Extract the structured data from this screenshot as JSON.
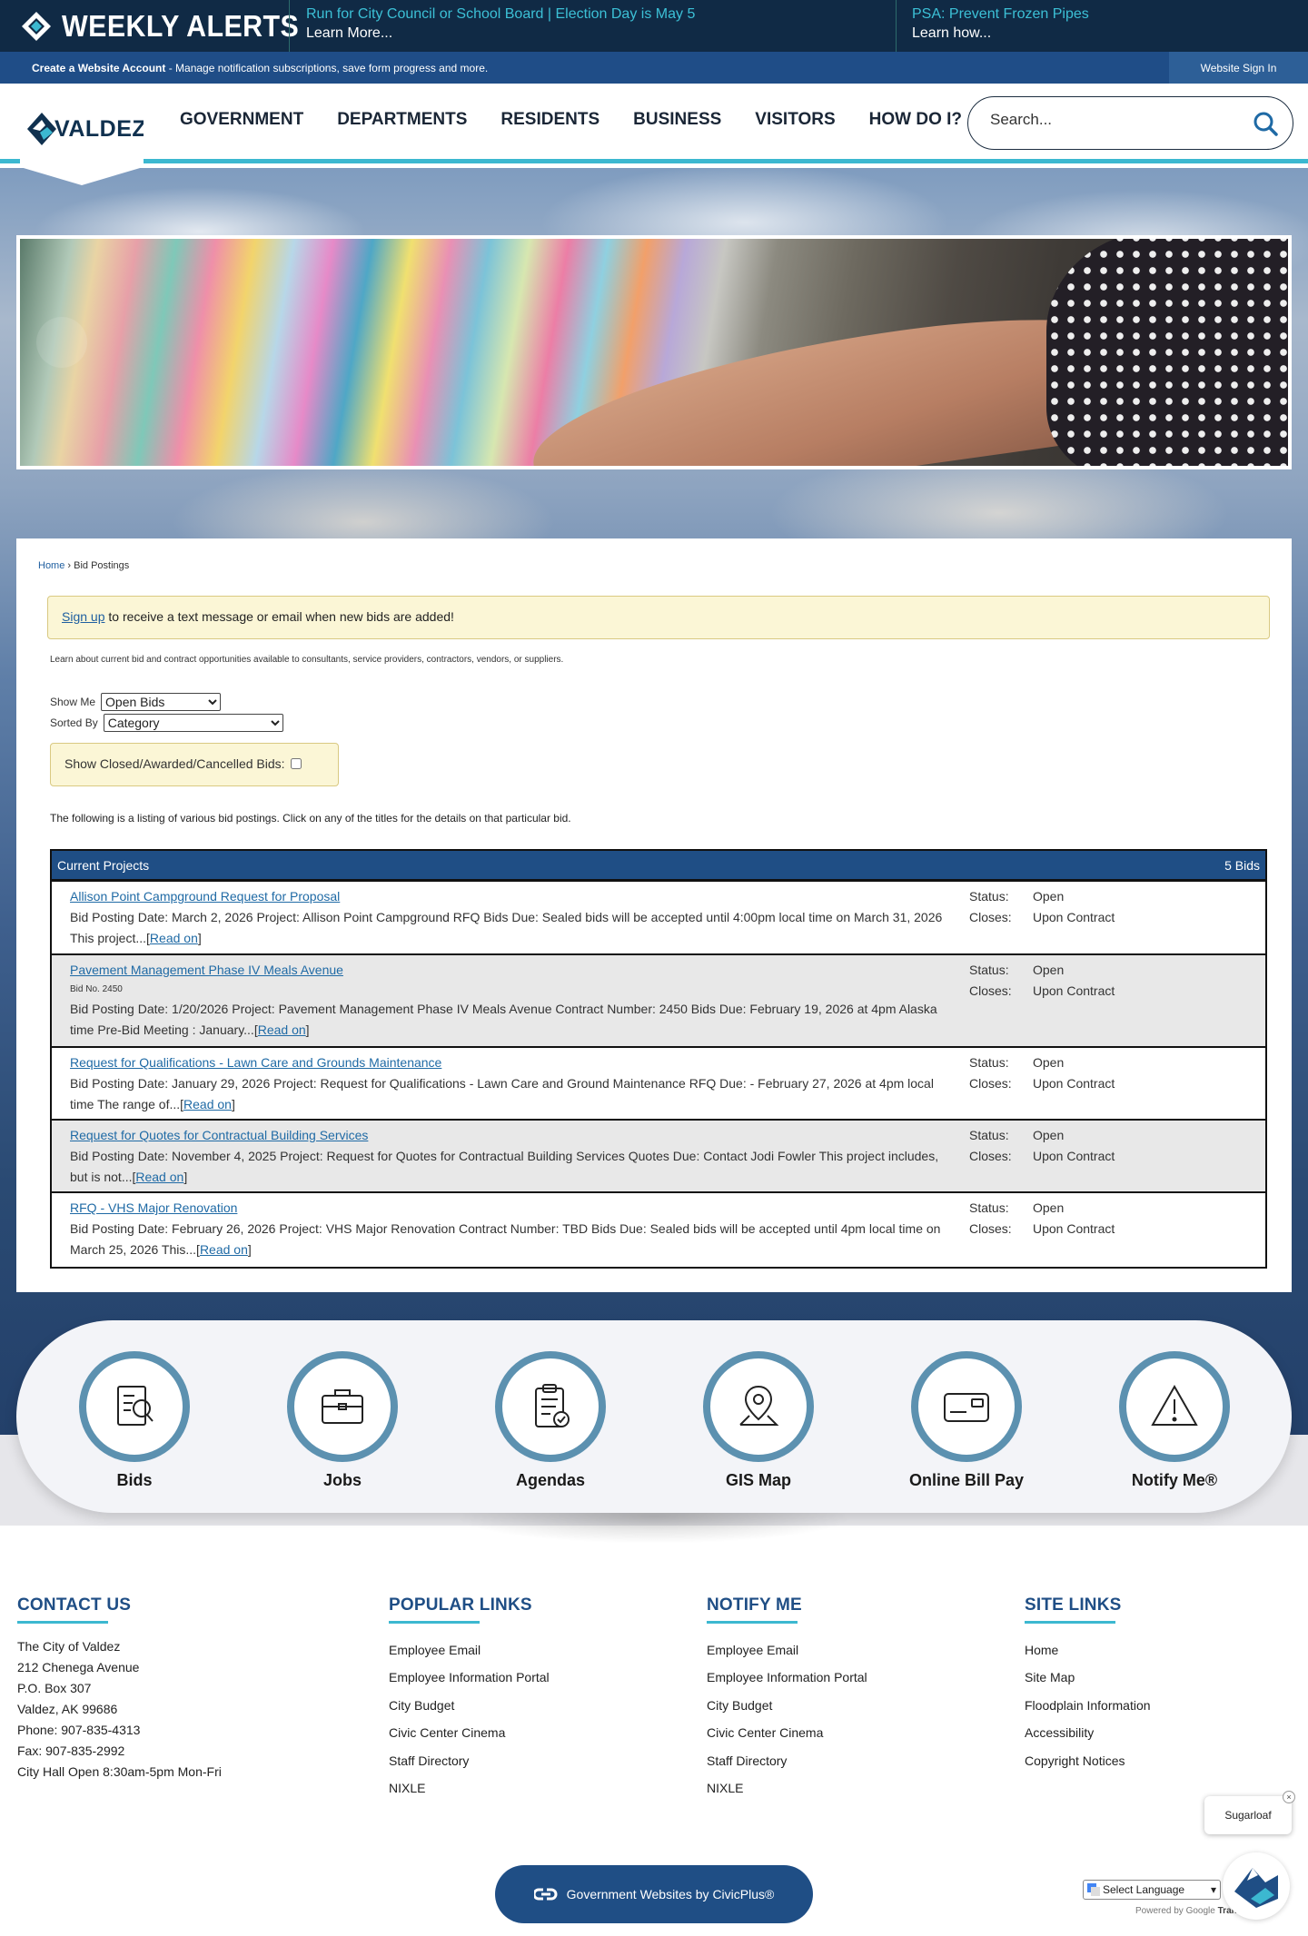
{
  "alerts": {
    "brand": "WEEKLY ALERTS",
    "items": [
      {
        "title": "Run for City Council or School Board | Election Day is May 5",
        "sub": "Learn More..."
      },
      {
        "title": "PSA: Prevent Frozen Pipes",
        "sub": "Learn how..."
      }
    ]
  },
  "account_bar": {
    "create": "Create a Website Account",
    "desc": " - Manage notification subscriptions, save form progress and more.",
    "signin": "Website Sign In"
  },
  "header": {
    "logo_text": "VALDEZ",
    "nav": [
      "GOVERNMENT",
      "DEPARTMENTS",
      "RESIDENTS",
      "BUSINESS",
      "VISITORS",
      "HOW DO I?"
    ],
    "search_placeholder": "Search..."
  },
  "breadcrumb": {
    "home": "Home",
    "sep": " › ",
    "current": "Bid Postings"
  },
  "signup": {
    "link": "Sign up",
    "text": " to receive a text message or email when new bids are added!"
  },
  "intro": "Learn about current bid and contract opportunities available to consultants, service providers, contractors, vendors, or suppliers.",
  "filters": {
    "show_label": "Show Me",
    "show_value": "Open Bids",
    "sort_label": "Sorted By",
    "sort_value": "Category",
    "closed_label": "Show Closed/Awarded/Cancelled Bids:"
  },
  "listing_note": "The following is a listing of various bid postings. Click on any of the titles for the details on that particular bid.",
  "bids": {
    "header": "Current Projects",
    "count": "5 Bids",
    "status_label": "Status:",
    "closes_label": "Closes:",
    "read_on": "Read on",
    "items": [
      {
        "title": "Allison Point Campground Request for Proposal",
        "bid_no": "",
        "desc": "Bid Posting Date: March 2, 2026 Project: Allison Point Campground RFQ Bids Due: Sealed bids will be accepted until 4:00pm local time on March 31, 2026 This project...",
        "status": "Open",
        "closes": "Upon Contract"
      },
      {
        "title": "Pavement Management Phase IV Meals Avenue",
        "bid_no": "Bid No. 2450",
        "desc": "Bid Posting Date: 1/20/2026 Project: Pavement Management Phase IV Meals Avenue Contract Number: 2450 Bids Due: February 19, 2026 at 4pm Alaska time Pre-Bid Meeting : January...",
        "status": "Open",
        "closes": "Upon Contract"
      },
      {
        "title": "Request for Qualifications - Lawn Care and Grounds Maintenance",
        "bid_no": "",
        "desc": "Bid Posting Date: January 29, 2026 Project: Request for Qualifications - Lawn Care and Ground Maintenance RFQ Due: - February 27, 2026 at 4pm local time The range of...",
        "status": "Open",
        "closes": "Upon Contract"
      },
      {
        "title": "Request for Quotes for Contractual Building Services",
        "bid_no": "",
        "desc": "Bid Posting Date: November 4, 2025 Project: Request for Quotes for Contractual Building Services Quotes Due: Contact Jodi Fowler This project includes, but is not...",
        "status": "Open",
        "closes": "Upon Contract"
      },
      {
        "title": "RFQ - VHS Major Renovation",
        "bid_no": "",
        "desc": "Bid Posting Date: February 26, 2026 Project: VHS Major Renovation Contract Number: TBD Bids Due: Sealed bids will be accepted until 4pm local time on March 25, 2026 This...",
        "status": "Open",
        "closes": "Upon Contract"
      }
    ]
  },
  "quick_links": [
    {
      "label": "Bids",
      "icon": "bids-document-icon"
    },
    {
      "label": "Jobs",
      "icon": "briefcase-icon"
    },
    {
      "label": "Agendas",
      "icon": "clipboard-check-icon"
    },
    {
      "label": "GIS Map",
      "icon": "map-pin-icon"
    },
    {
      "label": "Online Bill Pay",
      "icon": "credit-card-icon"
    },
    {
      "label": "Notify Me®",
      "icon": "warning-triangle-icon"
    }
  ],
  "footer": {
    "contact": {
      "title": "CONTACT US",
      "lines": [
        "The City of Valdez",
        "212 Chenega Avenue",
        "P.O. Box 307",
        "Valdez, AK 99686",
        "Phone: 907-835-4313",
        "Fax: 907-835-2992",
        "City Hall Open 8:30am-5pm Mon-Fri"
      ]
    },
    "popular": {
      "title": "POPULAR LINKS",
      "links": [
        "Employee Email",
        "Employee Information Portal",
        "City Budget",
        "Civic Center Cinema",
        "Staff Directory",
        "NIXLE"
      ]
    },
    "notify": {
      "title": "NOTIFY ME",
      "links": [
        "Employee Email",
        "Employee Information Portal",
        "City Budget",
        "Civic Center Cinema",
        "Staff Directory",
        "NIXLE"
      ]
    },
    "site": {
      "title": "SITE LINKS",
      "links": [
        "Home",
        "Site Map",
        "Floodplain Information",
        "Accessibility",
        "Copyright Notices"
      ]
    },
    "civicplus": "Government Websites by CivicPlus®",
    "chat_bubble": "Sugarloaf",
    "chat_close": "×",
    "language_select": "Select Language",
    "translate_prefix": "Powered by",
    "translate_google": "Google",
    "translate_word": "Translate"
  },
  "colors": {
    "alert_bg": "#102a45",
    "accent_teal": "#3cb8d0",
    "brand_blue": "#1f4e85",
    "link_blue": "#1f6aa5",
    "notice_yellow": "#fbf6d6"
  }
}
